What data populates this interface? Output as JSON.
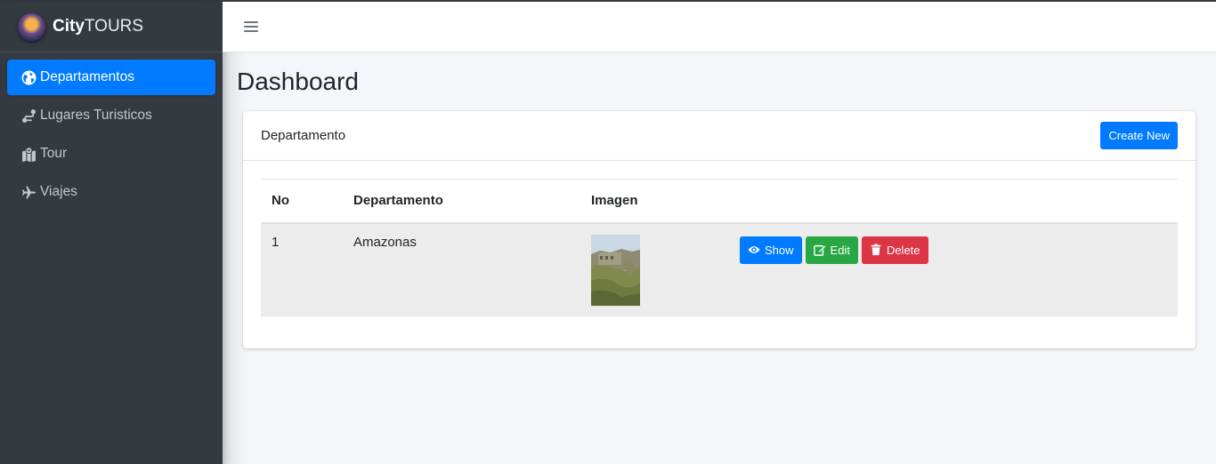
{
  "brand": {
    "strong": "City",
    "light": "TOURS"
  },
  "sidebar": {
    "items": [
      {
        "label": "Departamentos",
        "icon": "globe-icon",
        "active": true
      },
      {
        "label": "Lugares Turisticos",
        "icon": "route-icon",
        "active": false
      },
      {
        "label": "Tour",
        "icon": "map-marked-icon",
        "active": false
      },
      {
        "label": "Viajes",
        "icon": "plane-icon",
        "active": false
      }
    ]
  },
  "topbar": {
    "menu_icon": "hamburger-icon"
  },
  "page": {
    "title": "Dashboard"
  },
  "card": {
    "title": "Departamento",
    "create_label": "Create New"
  },
  "table": {
    "headers": [
      "No",
      "Departamento",
      "Imagen",
      ""
    ],
    "rows": [
      {
        "no": "1",
        "departamento": "Amazonas",
        "actions": {
          "show": "Show",
          "edit": "Edit",
          "delete": "Delete"
        }
      }
    ]
  },
  "colors": {
    "sidebar_bg": "#343a40",
    "primary": "#007bff",
    "success": "#28a745",
    "danger": "#dc3545",
    "content_bg": "#f4f6f9"
  }
}
